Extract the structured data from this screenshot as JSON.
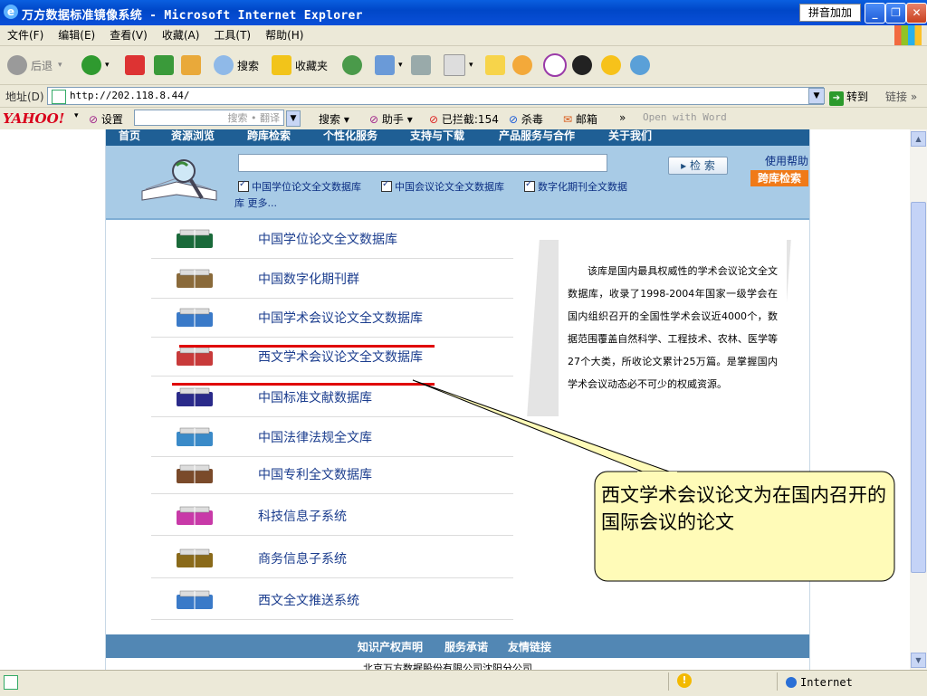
{
  "window": {
    "title": "万方数据标准镜像系统 - Microsoft Internet Explorer",
    "ime_label": "拼音加加"
  },
  "menu": [
    "文件(F)",
    "编辑(E)",
    "查看(V)",
    "收藏(A)",
    "工具(T)",
    "帮助(H)"
  ],
  "toolbar": {
    "back": "后退",
    "search": "搜索",
    "favorites": "收藏夹"
  },
  "address": {
    "label": "地址(D)",
    "url": "http://202.118.8.44/",
    "go": "转到",
    "links": "链接"
  },
  "yahoo": {
    "logo": "YAHOO!",
    "settings": "设置",
    "search_placeholder": "搜索 • 翻译",
    "search_btn": "搜索",
    "helper": "助手",
    "blocked": "已拦截:154",
    "antivirus": "杀毒",
    "mail": "邮箱",
    "word": "Open with Word"
  },
  "site": {
    "nav": [
      "首页",
      "资源浏览",
      "跨库检索",
      "个性化服务",
      "支持与下载",
      "产品服务与合作",
      "关于我们"
    ],
    "search": {
      "checks": [
        "中国学位论文全文数据库",
        "中国会议论文全文数据库",
        "数字化期刊全文数据"
      ],
      "more": "库 更多...",
      "button": "检 索",
      "help": "使用帮助",
      "cross": "跨库检索"
    },
    "databases": [
      {
        "label": "中国学位论文全文数据库",
        "icon": "graduation-cap-icon"
      },
      {
        "label": "中国数字化期刊群",
        "icon": "book-stack-icon"
      },
      {
        "label": "中国学术会议论文全文数据库",
        "icon": "open-book-icon"
      },
      {
        "label": "西文学术会议论文全文数据库",
        "icon": "open-book-red-icon"
      },
      {
        "label": "中国标准文献数据库",
        "icon": "bookshelf-icon"
      },
      {
        "label": "中国法律法规全文库",
        "icon": "colored-books-icon"
      },
      {
        "label": "中国专利全文数据库",
        "icon": "stacked-books-icon"
      },
      {
        "label": "科技信息子系统",
        "icon": "science-books-icon"
      },
      {
        "label": "商务信息子系统",
        "icon": "business-book-icon"
      },
      {
        "label": "西文全文推送系统",
        "icon": "open-book-icon"
      }
    ],
    "description": "该库是国内最具权威性的学术会议论文全文数据库，收录了1998-2004年国家一级学会在国内组织召开的全国性学术会议近4000个，数据范围覆盖自然科学、工程技术、农林、医学等27个大类，所收论文累计25万篇。是掌握国内学术会议动态必不可少的权威资源。",
    "footer": [
      "知识产权声明",
      "服务承诺",
      "友情链接"
    ],
    "copyright": "北京万方数据股份有限公司沈阳分公司"
  },
  "callout": {
    "text": "西文学术会议论文为在国内召开的国际会议的论文"
  },
  "status": {
    "zone": "Internet"
  }
}
